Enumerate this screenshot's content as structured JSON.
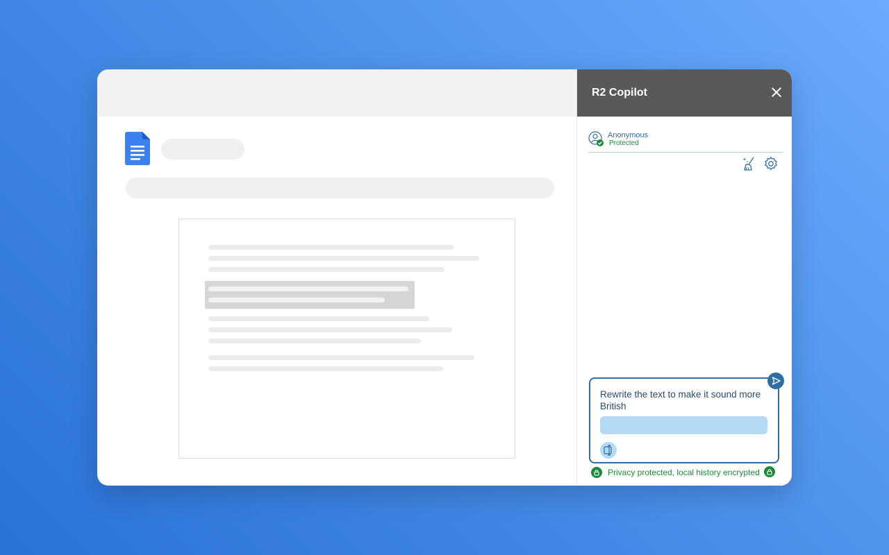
{
  "panel": {
    "title": "R2 Copilot",
    "close_icon": "close-icon",
    "user": {
      "name": "Anonymous",
      "status": "Protected"
    },
    "tools": [
      "clean-chat-icon",
      "gear-icon"
    ],
    "composer": {
      "text": "Rewrite the text to make it sound more British",
      "send_icon": "send-icon",
      "attach_icon": "text-cursor-icon"
    },
    "privacy_text": "Privacy protected, local history encrypted"
  },
  "document": {
    "app_icon": "google-docs-icon"
  },
  "colors": {
    "header": "#595959",
    "accent": "#2f6ea3",
    "success": "#1c8a3a",
    "highlight": "#b5daf6"
  }
}
